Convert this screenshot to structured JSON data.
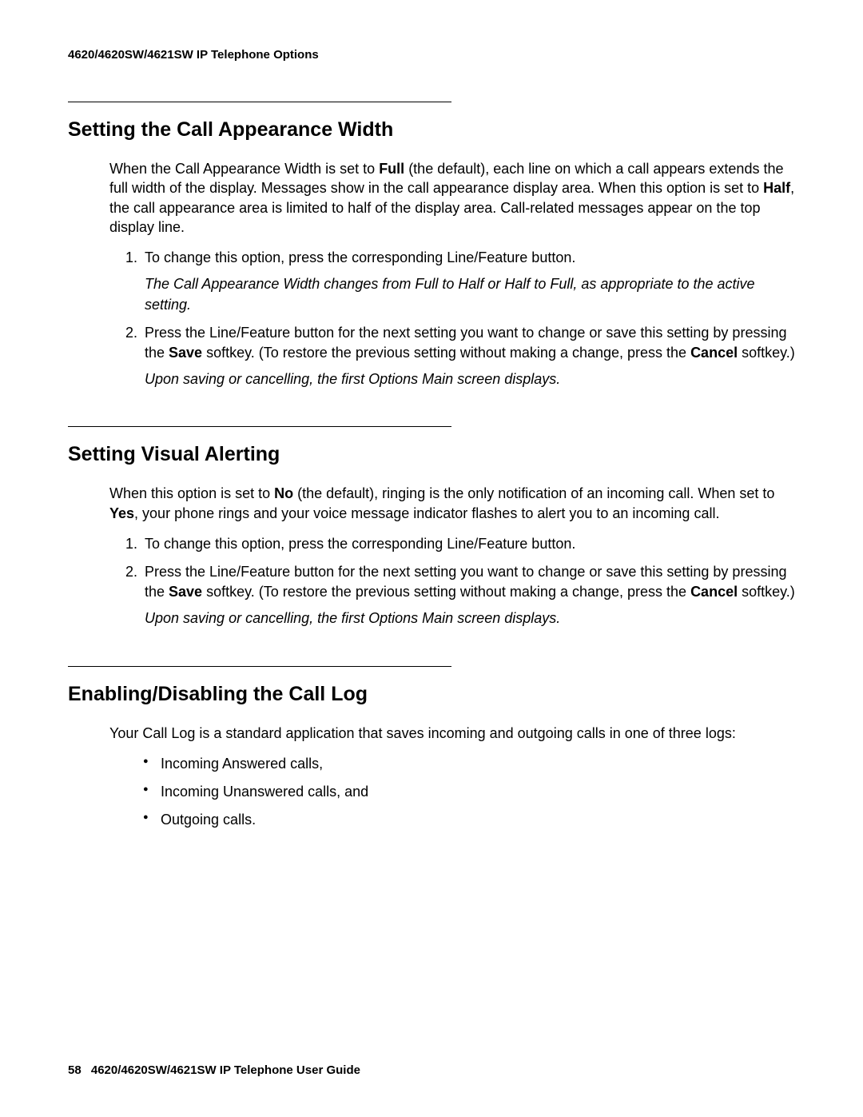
{
  "header": {
    "title": "4620/4620SW/4621SW IP Telephone Options"
  },
  "sections": [
    {
      "heading": "Setting the Call Appearance Width",
      "intro_parts": [
        "When the Call Appearance Width is set to ",
        "Full",
        " (the default), each line on which a call appears extends the full width of the display. Messages show in the call appearance display area. When this option is set to ",
        "Half",
        ", the call appearance area is limited to half of the display area. Call-related messages appear on the top display line."
      ],
      "list": [
        {
          "text": "To change this option, press the corresponding Line/Feature button.",
          "note": "The Call Appearance Width changes from Full to Half or Half to Full, as appropriate to the active setting."
        },
        {
          "parts": [
            "Press the Line/Feature button for the next setting you want to change or save this setting by pressing the ",
            "Save",
            " softkey. (To restore the previous setting without making a change, press the ",
            "Cancel",
            " softkey.)"
          ],
          "note": "Upon saving or cancelling, the first Options Main screen displays."
        }
      ]
    },
    {
      "heading": "Setting Visual Alerting",
      "intro_parts": [
        "When this option is set to ",
        "No",
        " (the default), ringing is the only notification of an incoming call. When set to ",
        "Yes",
        ", your phone rings and your voice message indicator flashes to alert you to an incoming call."
      ],
      "list": [
        {
          "text": "To change this option, press the corresponding Line/Feature button."
        },
        {
          "parts": [
            "Press the Line/Feature button for the next setting you want to change or save this setting by pressing the ",
            "Save",
            " softkey. (To restore the previous setting without making a change, press the ",
            "Cancel",
            " softkey.)"
          ],
          "note": "Upon saving or cancelling, the first Options Main screen displays."
        }
      ]
    },
    {
      "heading": "Enabling/Disabling the Call Log",
      "intro_text": "Your Call Log is a standard application that saves incoming and outgoing calls in one of three logs:",
      "bullets": [
        "Incoming Answered calls,",
        "Incoming Unanswered calls, and",
        "Outgoing calls."
      ]
    }
  ],
  "footer": {
    "page": "58",
    "guide": "4620/4620SW/4621SW IP Telephone User Guide"
  }
}
